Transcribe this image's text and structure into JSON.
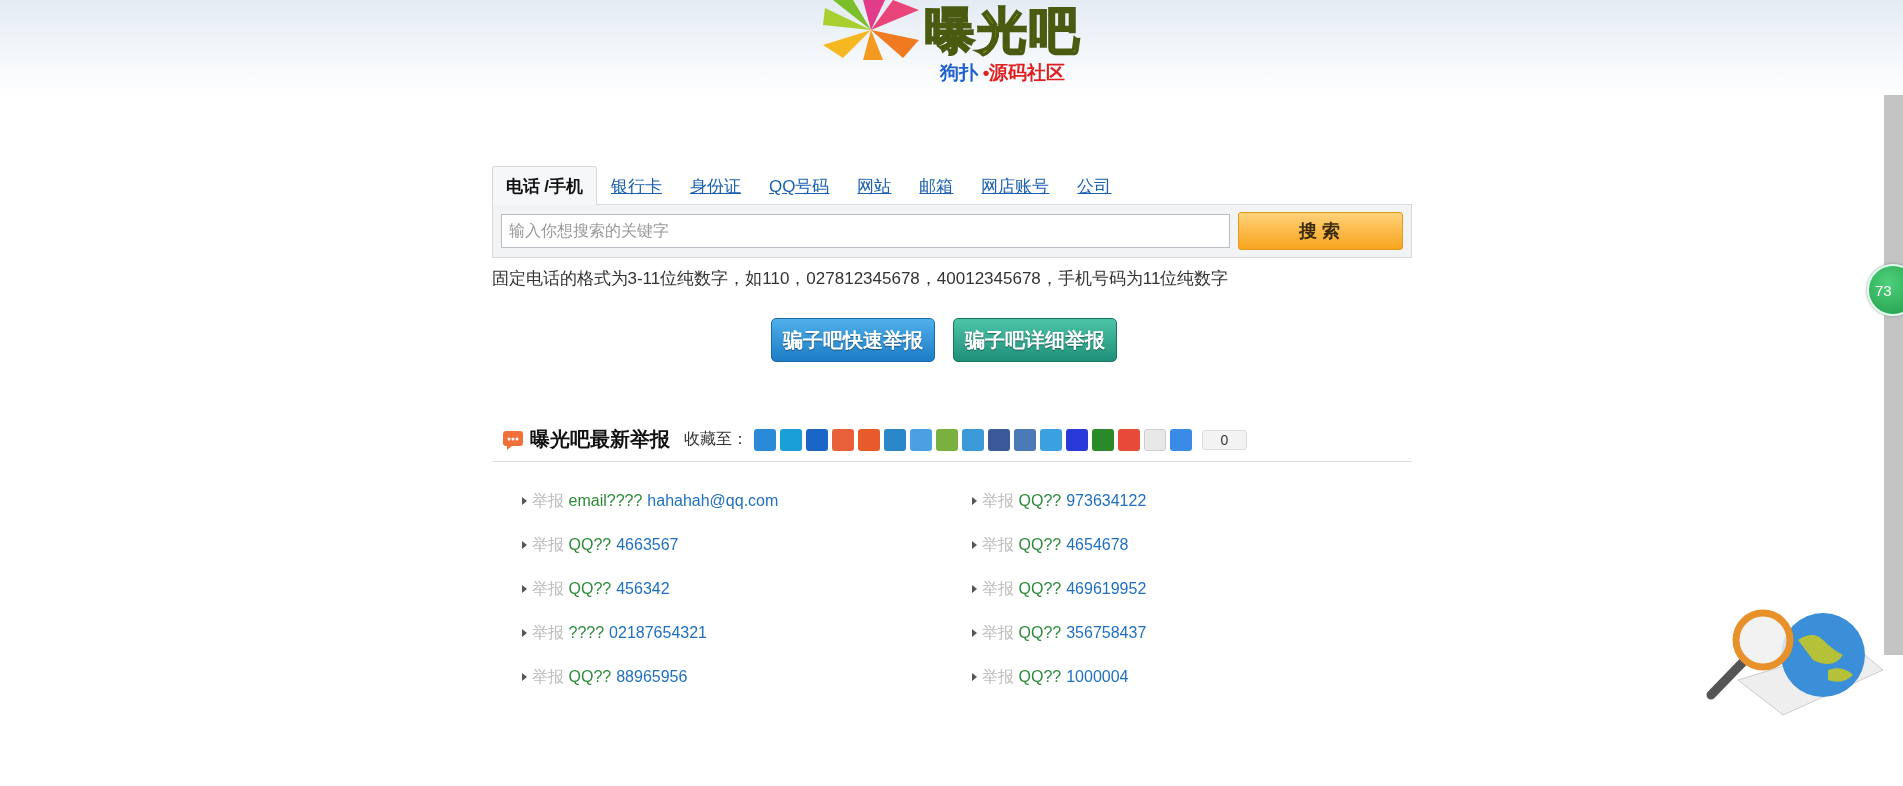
{
  "logo": {
    "title": "曝光吧",
    "tagline_left": "狗扑",
    "tagline_right": "•源码社区"
  },
  "search": {
    "tabs": [
      {
        "label": "电话 /手机",
        "selected": true
      },
      {
        "label": "银行卡",
        "selected": false
      },
      {
        "label": "身份证",
        "selected": false
      },
      {
        "label": "QQ号码",
        "selected": false
      },
      {
        "label": "网站",
        "selected": false
      },
      {
        "label": "邮箱",
        "selected": false
      },
      {
        "label": "网店账号",
        "selected": false
      },
      {
        "label": "公司",
        "selected": false
      }
    ],
    "placeholder": "输入你想搜索的关键字",
    "button": "搜 索",
    "hint": "固定电话的格式为3-11位纯数字，如110，027812345678，40012345678，手机号码为11位纯数字"
  },
  "report_buttons": [
    {
      "label": "骗子吧快速举报",
      "kind": "quick"
    },
    {
      "label": "骗子吧详细举报",
      "kind": "detail"
    }
  ],
  "latest": {
    "title": "曝光吧最新举报",
    "share_label": "收藏至：",
    "share_count": "0",
    "items": [
      {
        "tag": "举报",
        "type": "email????",
        "value": "hahahah@qq.com"
      },
      {
        "tag": "举报",
        "type": "QQ??",
        "value": "973634122"
      },
      {
        "tag": "举报",
        "type": "QQ??",
        "value": "4663567"
      },
      {
        "tag": "举报",
        "type": "QQ??",
        "value": "4654678"
      },
      {
        "tag": "举报",
        "type": "QQ??",
        "value": "456342"
      },
      {
        "tag": "举报",
        "type": "QQ??",
        "value": "469619952"
      },
      {
        "tag": "举报",
        "type": "????",
        "value": "02187654321"
      },
      {
        "tag": "举报",
        "type": "QQ??",
        "value": "356758437"
      },
      {
        "tag": "举报",
        "type": "QQ??",
        "value": "88965956"
      },
      {
        "tag": "举报",
        "type": "QQ??",
        "value": "1000004"
      }
    ]
  },
  "side_badge": "73"
}
